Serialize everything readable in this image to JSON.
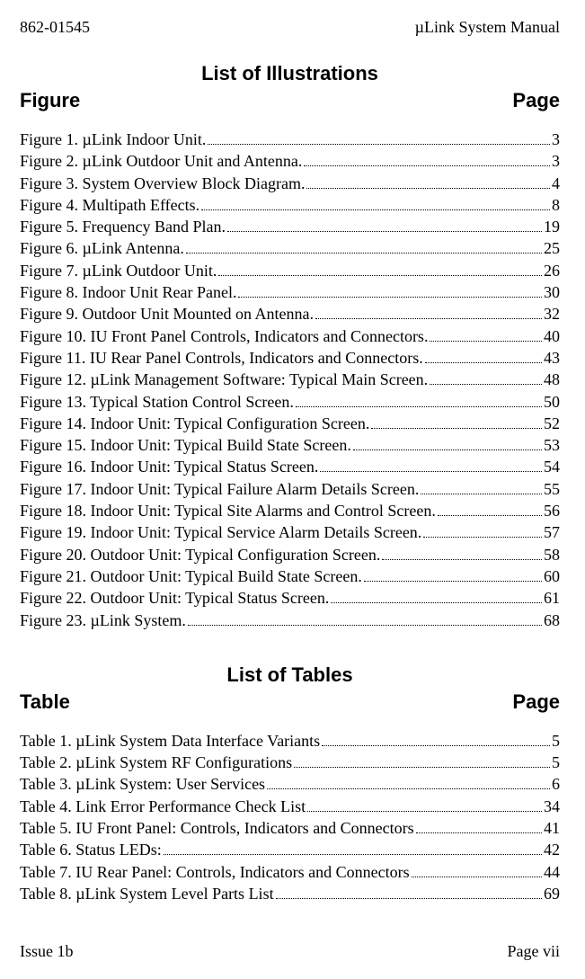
{
  "header": {
    "left": "862-01545",
    "right": "µLink System Manual"
  },
  "illustrations": {
    "section_title": "List of Illustrations",
    "col_left": "Figure",
    "col_right": "Page",
    "items": [
      {
        "label": "Figure 1.  µLink Indoor Unit.",
        "page": "3"
      },
      {
        "label": "Figure 2.  µLink Outdoor Unit and Antenna.",
        "page": "3"
      },
      {
        "label": "Figure 3.  System Overview Block Diagram.",
        "page": "4"
      },
      {
        "label": "Figure 4.  Multipath Effects.",
        "page": "8"
      },
      {
        "label": "Figure 5.  Frequency Band Plan.",
        "page": "19"
      },
      {
        "label": "Figure 6.  µLink Antenna.",
        "page": "25"
      },
      {
        "label": "Figure 7.  µLink Outdoor Unit.",
        "page": "26"
      },
      {
        "label": "Figure 8.  Indoor Unit Rear Panel.",
        "page": "30"
      },
      {
        "label": "Figure 9.  Outdoor Unit Mounted on Antenna.",
        "page": "32"
      },
      {
        "label": "Figure 10.  IU Front Panel Controls, Indicators and Connectors.",
        "page": "40"
      },
      {
        "label": "Figure 11.  IU Rear Panel Controls, Indicators and Connectors.",
        "page": "43"
      },
      {
        "label": "Figure 12.  µLink Management Software:  Typical Main Screen.",
        "page": "48"
      },
      {
        "label": "Figure 13.  Typical Station Control Screen.",
        "page": "50"
      },
      {
        "label": "Figure 14.  Indoor Unit:  Typical Configuration Screen.",
        "page": "52"
      },
      {
        "label": "Figure 15.  Indoor Unit:  Typical Build State Screen.",
        "page": "53"
      },
      {
        "label": "Figure 16.  Indoor Unit:  Typical Status Screen.",
        "page": "54"
      },
      {
        "label": "Figure 17.  Indoor Unit:  Typical Failure Alarm Details Screen.",
        "page": "55"
      },
      {
        "label": "Figure 18.  Indoor Unit:  Typical Site Alarms and Control Screen.",
        "page": "56"
      },
      {
        "label": "Figure 19.  Indoor Unit:  Typical Service Alarm Details Screen.",
        "page": "57"
      },
      {
        "label": "Figure 20.  Outdoor Unit:  Typical Configuration Screen.",
        "page": "58"
      },
      {
        "label": "Figure 21.  Outdoor Unit:  Typical Build State Screen.",
        "page": "60"
      },
      {
        "label": "Figure 22.  Outdoor Unit:  Typical Status Screen.",
        "page": "61"
      },
      {
        "label": "Figure 23.  µLink System.",
        "page": "68"
      }
    ]
  },
  "tables": {
    "section_title": "List of Tables",
    "col_left": "Table",
    "col_right": "Page",
    "items": [
      {
        "label": "Table 1.  µLink System Data Interface Variants",
        "page": "5"
      },
      {
        "label": "Table 2.  µLink System RF Configurations",
        "page": "5"
      },
      {
        "label": "Table 3.  µLink System:  User Services",
        "page": "6"
      },
      {
        "label": "Table 4.  Link Error Performance Check List",
        "page": "34"
      },
      {
        "label": "Table 5.  IU Front Panel:  Controls, Indicators and Connectors",
        "page": "41"
      },
      {
        "label": "Table 6.  Status LEDs:",
        "page": "42"
      },
      {
        "label": "Table 7.  IU Rear Panel:  Controls, Indicators and Connectors",
        "page": "44"
      },
      {
        "label": "Table 8.  µLink System Level Parts List",
        "page": "69"
      }
    ]
  },
  "footer": {
    "left": "Issue 1b",
    "right": "Page vii"
  }
}
